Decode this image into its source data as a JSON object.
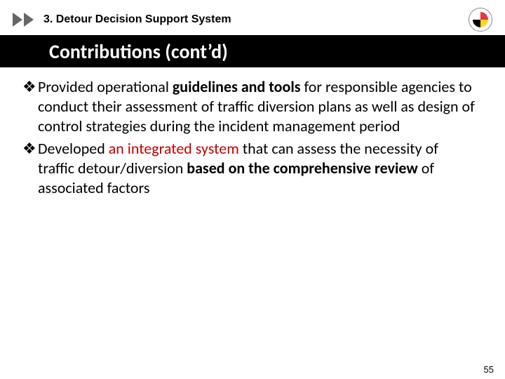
{
  "header": {
    "section_label": "3. Detour Decision Support System",
    "title": "Contributions (cont’d)",
    "logo_alt": "University of Maryland seal"
  },
  "bullets": [
    {
      "segments": [
        {
          "text": "Provided operational ",
          "bold": false,
          "red": false
        },
        {
          "text": "guidelines and tools",
          "bold": true,
          "red": false
        },
        {
          "text": " for responsible agencies to conduct their assessment of traffic diversion plans as well as design of control strategies during the incident management period",
          "bold": false,
          "red": false
        }
      ]
    },
    {
      "segments": [
        {
          "text": "Developed ",
          "bold": false,
          "red": false
        },
        {
          "text": "an integrated system",
          "bold": false,
          "red": true
        },
        {
          "text": " that can assess the necessity of traffic detour/diversion ",
          "bold": false,
          "red": false
        },
        {
          "text": "based on the comprehensive review",
          "bold": true,
          "red": false
        },
        {
          "text": " of associated factors",
          "bold": false,
          "red": false
        }
      ]
    }
  ],
  "page_number": "55",
  "bullet_glyph": "❖"
}
